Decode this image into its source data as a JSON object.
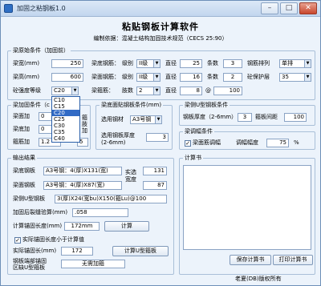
{
  "window": {
    "title": "加固之粘钢板1.0",
    "min": "–",
    "max": "□",
    "close": "✕"
  },
  "header": {
    "title": "粘贴钢板计算软件",
    "subtitle": "编制依据：混凝土结构加固技术规范（CECS 25:90）"
  },
  "original": {
    "title": "梁原始条件（加固前）",
    "width_label": "梁宽(mm)",
    "width": "250",
    "height_label": "梁高(mm)",
    "height": "600",
    "concrete_label": "砼强度等级",
    "concrete": "C20",
    "bottom_label": "梁底钢筋：",
    "bottom_grade_label": "级别",
    "bottom_grade": "II级",
    "bottom_dia_label": "直径",
    "bottom_dia": "25",
    "bottom_count_label": "条数",
    "bottom_count": "3",
    "arrange_label": "钢筋排列",
    "arrange": "单排",
    "top_label": "梁面钢筋：",
    "top_grade_label": "级别",
    "top_grade": "II级",
    "top_dia_label": "直径",
    "top_dia": "16",
    "top_count_label": "条数",
    "top_count": "2",
    "cover_label": "砼保护层",
    "cover": "35",
    "stirrup_label": "梁箍筋：",
    "stirrup_legs_label": "肢数",
    "stirrup_legs": "2",
    "stirrup_dia_label": "直径",
    "stirrup_dia": "8",
    "stirrup_at": "@",
    "stirrup_spacing": "100"
  },
  "concrete_options": [
    "C10",
    "C15",
    "C20",
    "C25",
    "C30",
    "C35",
    "C40"
  ],
  "after": {
    "title": "梁加固条件（c",
    "l1": "梁面加",
    "l2": "梁底加",
    "l3": "箍筋加",
    "v1": "0",
    "v2": "0",
    "v3": "1.2",
    "side": [
      "箍",
      "肢",
      "加"
    ],
    "suffix": "5"
  },
  "top_plate": {
    "title": "梁底面贴钢板条件(mm)",
    "steel_label": "选用钢材",
    "steel": "A3号钢",
    "thick_label1": "选用钢板厚度",
    "thick_label2": "(2-6mm)",
    "thick": "3"
  },
  "side_plate": {
    "title": "梁侧U型钢板条件",
    "thick_label": "钢板厚度（2-6mm）",
    "thick": "3",
    "spacing_label": "箍板间距",
    "spacing": "100"
  },
  "adjust": {
    "title": "梁调幅条件",
    "check_label": "梁面筋调幅",
    "check": "✓",
    "range_label": "调幅幅度",
    "range": "75",
    "unit": "%"
  },
  "output": {
    "title": "输出结果",
    "bottom_label": "梁底钢板",
    "bottom_value": "A3号钢：4(厚)X131(宽)",
    "actual_label1": "实选",
    "actual_label2": "宽度",
    "actual_width": "131",
    "top_label": "梁面钢板",
    "top_value": "A3号钢：4(厚)X87(宽)",
    "top_width": "87",
    "side_label": "梁侧U型钢板",
    "side_value": "3(厚)X24(宽bu)X150(箍Lu)@100",
    "check_label": "加固后裂缝验算(mm)",
    "check_value": ".058",
    "anchor_label": "计算锚固长度(mm)",
    "anchor_value": "172mm",
    "calc": "计算",
    "actual_check_label": "实际锚固长度小于计算值",
    "actual_check": "✓",
    "actual_anchor_label": "实际锚固长(mm)",
    "actual_anchor": "172",
    "u_btn": "计算U型箍板",
    "end_label1": "钢板端部锚固",
    "end_label2": "区缺U型箍板",
    "end_value": "无需加箍"
  },
  "calcbook": {
    "title": "计算书",
    "save": "保存计算书",
    "print": "打印计算书"
  },
  "footer": {
    "copyright": "老夏(DB)版权所有"
  }
}
